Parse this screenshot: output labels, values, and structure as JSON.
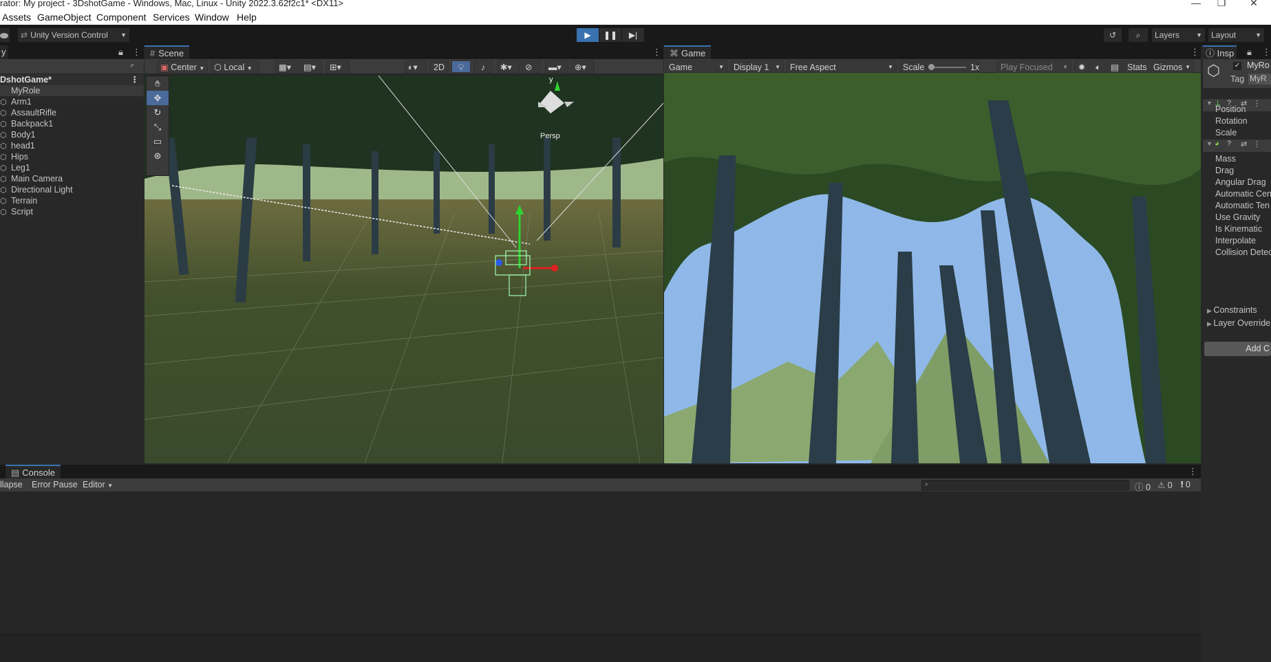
{
  "window": {
    "title": "rator: My project - 3DshotGame - Windows, Mac, Linux - Unity 2022.3.62f2c1* <DX11>",
    "controls": [
      "—",
      "❐",
      "✕"
    ]
  },
  "menu": [
    "Assets",
    "GameObject",
    "Component",
    "Services",
    "Window",
    "Help"
  ],
  "toolbar": {
    "version_control": "Unity Version Control",
    "layers": "Layers",
    "layout": "Layout",
    "play_icon": "▶",
    "pause_icon": "❚❚",
    "step_icon": "▶|"
  },
  "hierarchy": {
    "tab": "y",
    "scene_name": "DshotGame*",
    "items": [
      {
        "label": "MyRole",
        "selected": true
      },
      {
        "label": "Arm1"
      },
      {
        "label": "AssaultRifle"
      },
      {
        "label": "Backpack1"
      },
      {
        "label": "Body1"
      },
      {
        "label": "head1"
      },
      {
        "label": "Hips"
      },
      {
        "label": "Leg1"
      },
      {
        "label": "Main Camera"
      },
      {
        "label": "Directional Light"
      },
      {
        "label": "Terrain"
      },
      {
        "label": "Script"
      }
    ]
  },
  "scene": {
    "tab": "Scene",
    "pivot": "Center",
    "space": "Local",
    "mode_2d": "2D",
    "gizmo_label": "Persp",
    "gizmo_y": "y"
  },
  "game": {
    "tab": "Game",
    "view": "Game",
    "display": "Display 1",
    "aspect": "Free Aspect",
    "scale_label": "Scale",
    "scale_value": "1x",
    "play_focused": "Play Focused",
    "stats": "Stats",
    "gizmos": "Gizmos"
  },
  "inspector": {
    "tab": "Insp",
    "object_name": "MyRo",
    "tag_label": "Tag",
    "tag_value": "MyR",
    "transform_fields": [
      "Position",
      "Rotation",
      "Scale"
    ],
    "rigidbody_fields": [
      "Mass",
      "Drag",
      "Angular Drag",
      "Automatic Cen",
      "Automatic Ten",
      "Use Gravity",
      "Is Kinematic",
      "Interpolate",
      "Collision Detec"
    ],
    "foldouts": [
      "Constraints",
      "Layer Override"
    ],
    "add_component": "Add C"
  },
  "console": {
    "tab": "Console",
    "collapse": "llapse",
    "error_pause": "Error Pause",
    "editor": "Editor",
    "count_log": "0",
    "count_warn": "0",
    "count_error": "0"
  },
  "colors": {
    "accent": "#3a72b0",
    "panel_bg": "#282828",
    "toolbar_bg": "#191919",
    "tree_dark": "#1f3320",
    "sky": "#8fb8e8"
  }
}
